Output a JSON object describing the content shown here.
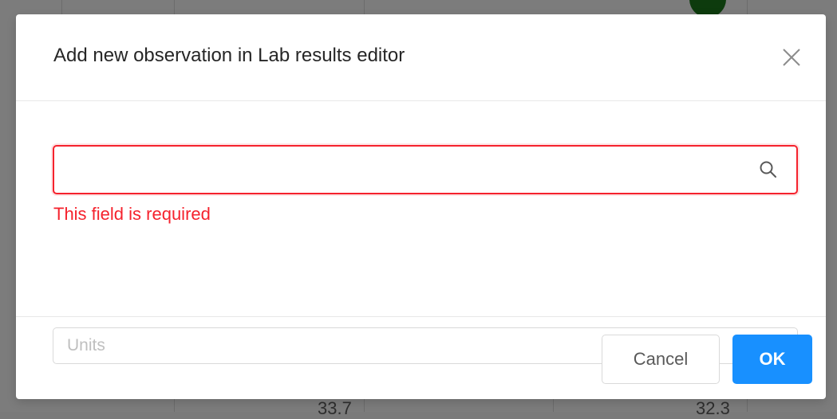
{
  "dialog": {
    "title": "Add new observation in Lab results editor",
    "close_icon": "close-icon"
  },
  "form": {
    "observation_search": {
      "value": "",
      "placeholder": "",
      "icon": "search-icon",
      "error": "This field is required",
      "border_color": "#f5222d"
    },
    "units": {
      "placeholder": "Units",
      "icon": "chevron-down-icon"
    }
  },
  "footer": {
    "cancel_label": "Cancel",
    "ok_label": "OK",
    "primary_color": "#1890ff"
  },
  "background": {
    "left_value": "33.7",
    "right_value": "32.3"
  }
}
